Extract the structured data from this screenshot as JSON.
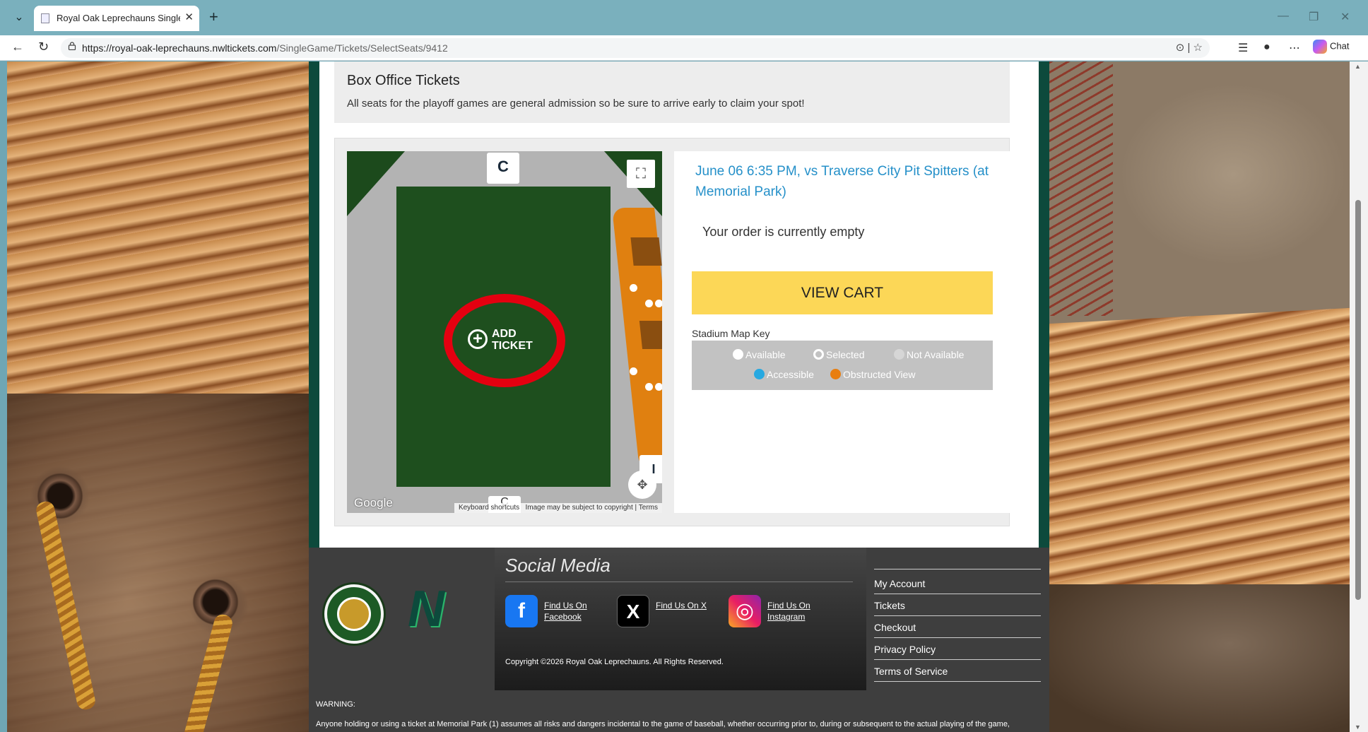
{
  "browser": {
    "tab_title": "Royal Oak Leprechauns Single Gam",
    "url_host": "https://royal-oak-leprechauns.nwltickets.com",
    "url_path": "/SingleGame/Tickets/SelectSeats/9412",
    "chat_label": "Chat"
  },
  "box_office": {
    "title": "Box Office Tickets",
    "description": "All seats for the playoff games are general admission so be sure to arrive early to claim your spot!"
  },
  "map": {
    "section_top": "C",
    "section_bottom": "C",
    "section_right": "I",
    "add_ticket_line1": "ADD",
    "add_ticket_line2": "TICKET",
    "google_label": "Google",
    "keyboard_shortcuts": "Keyboard shortcuts",
    "copyright_notice": "Image may be subject to copyright",
    "terms": "Terms"
  },
  "event": {
    "title": "June 06 6:35 PM, vs Traverse City Pit Spitters (at Memorial Park)",
    "order_status": "Your order is currently empty",
    "view_cart_label": "VIEW CART"
  },
  "map_key": {
    "title": "Stadium Map Key",
    "items": [
      {
        "label": "Available",
        "color": "#ffffff"
      },
      {
        "label": "Selected",
        "color": "#ffffff"
      },
      {
        "label": "Not Available",
        "color": "#d6d6d6"
      },
      {
        "label": "Accessible",
        "color": "#27a9e1"
      },
      {
        "label": "Obstructed View",
        "color": "#e87e10"
      }
    ]
  },
  "footer": {
    "social_title": "Social Media",
    "facebook_l1": "Find Us On",
    "facebook_l2": "Facebook",
    "x_label": "Find Us On X",
    "instagram_l1": "Find Us On",
    "instagram_l2": "Instagram",
    "copyright": "Copyright ©2026 Royal Oak Leprechauns. All Rights Reserved.",
    "links": [
      "My Account",
      "Tickets",
      "Checkout",
      "Privacy Policy",
      "Terms of Service"
    ],
    "warning_heading": "WARNING:",
    "warning_text": "Anyone holding or using a ticket at Memorial Park (1) assumes all risks and dangers incidental to the game of baseball, whether occurring prior to, during or subsequent to the actual playing of the game,"
  },
  "colors": {
    "brand_green": "#0d4a3c",
    "event_blue": "#2590c9",
    "cart_yellow": "#fcd757",
    "circle_red": "#e40010"
  }
}
